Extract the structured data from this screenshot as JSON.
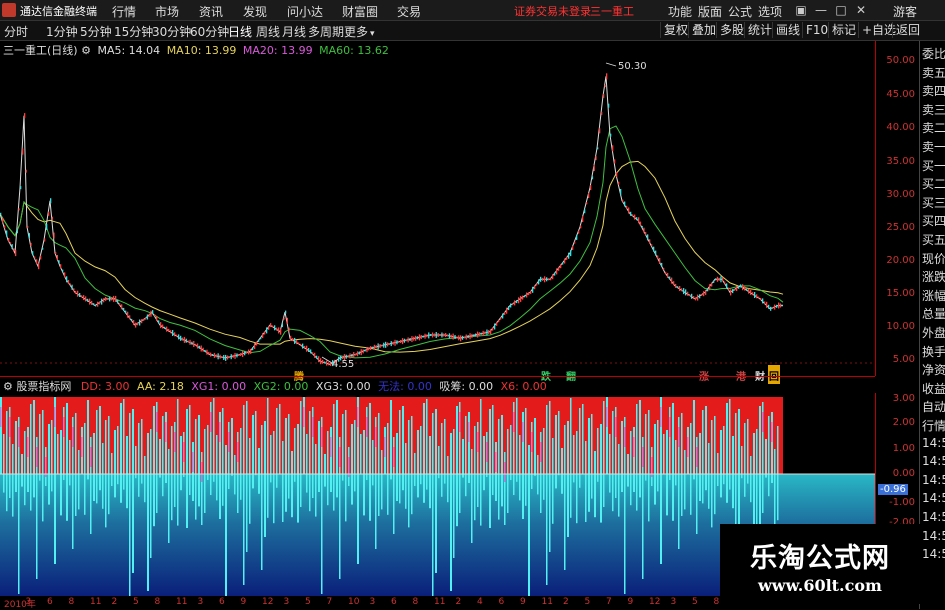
{
  "app": {
    "title": "通达信金融终端"
  },
  "menu": [
    "行情",
    "市场",
    "资讯",
    "发现",
    "问小达",
    "财富圈",
    "交易"
  ],
  "status_notice": "证券交易未登录",
  "stock_name_top": "三一重工",
  "top_right": [
    "功能",
    "版面",
    "公式",
    "选项"
  ],
  "guest_label": "游客",
  "periods": [
    "分时",
    "1分钟",
    "5分钟",
    "15分钟",
    "30分钟",
    "60分钟",
    "日线",
    "周线",
    "月线",
    "多周期",
    "更多"
  ],
  "active_period": "日线",
  "toolbar_right": [
    "复权",
    "叠加",
    "多股",
    "统计",
    "画线",
    "F10",
    "标记",
    "+自选",
    "返回"
  ],
  "main_info": {
    "title": "三一重工(日线)",
    "ma5": "MA5: 14.04",
    "ma10": "MA10: 13.99",
    "ma20": "MA20: 13.99",
    "ma60": "MA60: 13.62"
  },
  "price_high_label": "50.30",
  "price_low_label": "4.55",
  "y_ticks_main": [
    "50.00",
    "45.00",
    "40.00",
    "35.00",
    "30.00",
    "25.00",
    "20.00",
    "15.00",
    "10.00",
    "5.00"
  ],
  "events": [
    {
      "label": "腾",
      "color": "#e6a600"
    },
    {
      "label": "跌",
      "color": "#3c6"
    },
    {
      "label": "翻",
      "color": "#3c6"
    },
    {
      "label": "涨",
      "color": "#c44"
    },
    {
      "label": "港",
      "color": "#c44"
    },
    {
      "label": "财",
      "color": "#ddd"
    },
    {
      "label": "回",
      "color": "#e6a600"
    }
  ],
  "sub_info": {
    "title": "股票指标网",
    "dd": "DD: 3.00",
    "aa": "AA: 2.18",
    "xg1": "XG1: 0.00",
    "xg2": "XG2: 0.00",
    "xg3": "XG3: 0.00",
    "xx": "无法: 0.00",
    "xm": "吸筹: 0.00",
    "x6": "X6: 0.00"
  },
  "y_ticks_sub": [
    "3.00",
    "2.00",
    "1.00",
    "0.00",
    "-1.00",
    "-2.00"
  ],
  "sub_current": "-0.96",
  "side_items": [
    "委比",
    "卖五",
    "卖四",
    "卖三",
    "卖二",
    "卖一",
    "买一",
    "买二",
    "买三",
    "买四",
    "买五",
    "现价",
    "涨跌",
    "涨幅",
    "总量",
    "外盘",
    "换手",
    "净资",
    "收益",
    "自动",
    "行情",
    "14:50",
    "14:50",
    "14:50",
    "14:50",
    "14:50",
    "14:50",
    "14:50"
  ],
  "x_labels": [
    "2010年",
    "3",
    "6",
    "8",
    "11",
    "2",
    "5",
    "8",
    "11",
    "3",
    "6",
    "9",
    "12",
    "3",
    "5",
    "7",
    "10",
    "3",
    "6",
    "8",
    "11",
    "2",
    "4",
    "6",
    "9",
    "11",
    "2",
    "5",
    "7",
    "9",
    "12",
    "3",
    "5",
    "8",
    "11",
    "3",
    "5",
    "7",
    "9",
    "11"
  ],
  "watermark": {
    "title": "乐淘公式网",
    "url": "www.60lt.com"
  }
}
